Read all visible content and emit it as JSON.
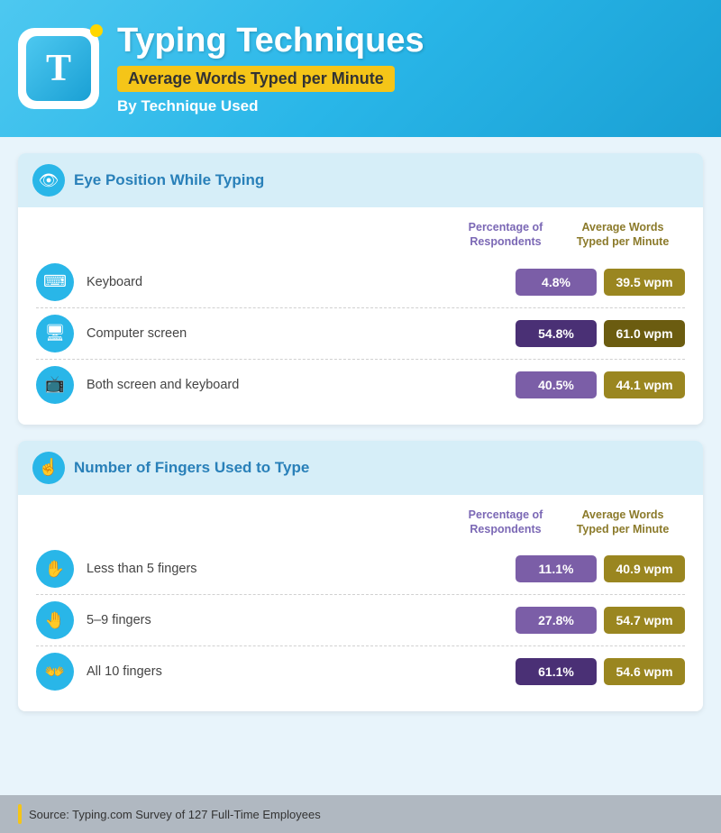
{
  "header": {
    "logo_letter": "T",
    "title": "Typing Techniques",
    "subtitle_badge": "Average Words Typed per Minute",
    "sub": "By Technique Used"
  },
  "section1": {
    "icon": "👁",
    "title": "Eye Position While Typing",
    "col1_header": "Percentage of Respondents",
    "col2_header": "Average Words Typed per Minute",
    "rows": [
      {
        "icon": "⌨",
        "label": "Keyboard",
        "pct": "4.8%",
        "wpm": "39.5 wpm",
        "pct_dark": false,
        "wpm_dark": false
      },
      {
        "icon": "🖥",
        "label": "Computer screen",
        "pct": "54.8%",
        "wpm": "61.0 wpm",
        "pct_dark": true,
        "wpm_dark": true
      },
      {
        "icon": "📺",
        "label": "Both screen and keyboard",
        "pct": "40.5%",
        "wpm": "44.1 wpm",
        "pct_dark": false,
        "wpm_dark": false
      }
    ]
  },
  "section2": {
    "icon": "👆",
    "title": "Number of Fingers Used to Type",
    "col1_header": "Percentage of Respondents",
    "col2_header": "Average Words Typed per Minute",
    "rows": [
      {
        "icon": "✋",
        "label": "Less than 5 fingers",
        "pct": "11.1%",
        "wpm": "40.9 wpm",
        "pct_dark": false,
        "wpm_dark": false
      },
      {
        "icon": "🤚",
        "label": "5–9 fingers",
        "pct": "27.8%",
        "wpm": "54.7 wpm",
        "pct_dark": false,
        "wpm_dark": false
      },
      {
        "icon": "👐",
        "label": "All 10 fingers",
        "pct": "61.1%",
        "wpm": "54.6 wpm",
        "pct_dark": true,
        "wpm_dark": false
      }
    ]
  },
  "footer": {
    "text": "Source: Typing.com Survey of 127 Full-Time Employees"
  }
}
